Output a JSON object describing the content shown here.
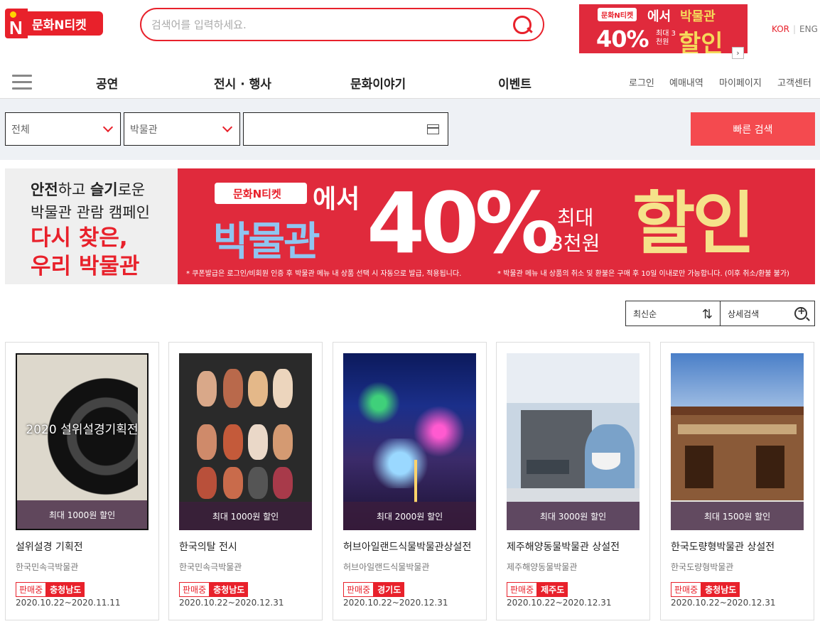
{
  "header": {
    "logo_text": "문화N티켓",
    "search_placeholder": "검색어를 입력하세요.",
    "top_ad": {
      "logo": "문화N티켓",
      "from": "에서",
      "museum": "박물관",
      "percent": "40%",
      "max": "최대 3천원",
      "sale": "할인"
    },
    "ad_next": "›",
    "lang": {
      "kor": "KOR",
      "sep": "|",
      "eng": "ENG"
    }
  },
  "nav": {
    "items": [
      "공연",
      "전시 · 행사",
      "문화이야기",
      "이벤트"
    ],
    "utilities": [
      "로그인",
      "예매내역",
      "마이페이지",
      "고객센터"
    ]
  },
  "filters": {
    "category": "전체",
    "type": "박물관",
    "date": "",
    "quick_search": "빠른 검색"
  },
  "banner": {
    "left": {
      "line1_a": "안전",
      "line1_b": "하고 ",
      "line1_c": "슬기",
      "line1_d": "로운",
      "line2": "박물관 관람 캠페인",
      "line3": "다시 찾은,",
      "line4": "우리 박물관"
    },
    "right": {
      "logo": "문화N티켓",
      "from": "에서",
      "museum": "박물관",
      "percent": "40%",
      "max1": "최대",
      "max2": "3천원",
      "sale": "할인",
      "note1": "* 쿠폰발급은 로그인/비회원 인증 후 박물관 메뉴 내 상품 선택 시 자동으로 발급, 적용됩니다.",
      "note2": "* 박물관 메뉴 내 상품의 취소 및 환불은 구매 후 10일 이내로만 가능합니다. (이후 취소/환불 불가)"
    }
  },
  "sort": {
    "order": "최신순",
    "detail": "상세검색"
  },
  "cards": [
    {
      "discount": "최대 1000원 할인",
      "title": "설위설경 기획전",
      "venue": "한국민속극박물관",
      "status": "판매중",
      "region": "충청남도",
      "dates": "2020.10.22~2020.11.11",
      "thumb_text": "2020 설위설경기획전"
    },
    {
      "discount": "최대 1000원 할인",
      "title": "한국의탈 전시",
      "venue": "한국민속극박물관",
      "status": "판매중",
      "region": "충청남도",
      "dates": "2020.10.22~2020.12.31"
    },
    {
      "discount": "최대 2000원 할인",
      "title": "허브아일랜드식물박물관상설전",
      "venue": "허브아일랜드식물박물관",
      "status": "판매중",
      "region": "경기도",
      "dates": "2020.10.22~2020.12.31"
    },
    {
      "discount": "최대 3000원 할인",
      "title": "제주해양동물박물관 상설전",
      "venue": "제주해양동물박물관",
      "status": "판매중",
      "region": "제주도",
      "dates": "2020.10.22~2020.12.31"
    },
    {
      "discount": "최대 1500원 할인",
      "title": "한국도량형박물관 상설전",
      "venue": "한국도량형박물관",
      "status": "판매중",
      "region": "충청남도",
      "dates": "2020.10.22~2020.12.31"
    }
  ]
}
